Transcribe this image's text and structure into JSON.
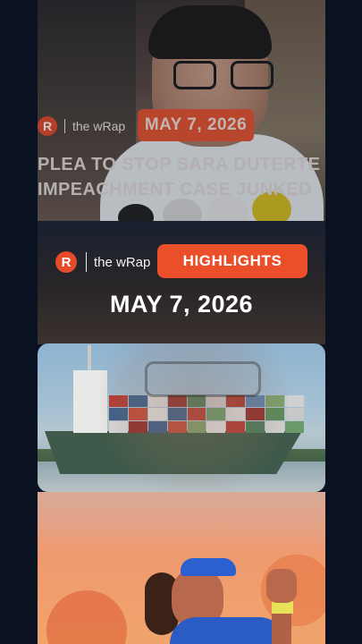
{
  "top_card": {
    "brand_logo": "R",
    "brand_name": "the wRap",
    "date": "MAY 7, 2026",
    "headline_line1": "PLEA TO STOP SARA DUTERTE",
    "headline_line2": "IMPEACHMENT CASE JUNKED"
  },
  "header": {
    "brand_logo": "R",
    "brand_name": "the wRap",
    "section_chip": "HIGHLIGHTS",
    "date": "MAY 7, 2026"
  },
  "colors": {
    "accent": "#ea4f2a",
    "background": "#0b1222",
    "text": "#ffffff"
  },
  "media": {
    "story_thumbnails": [
      "ship-image",
      "tennis-player-image"
    ]
  }
}
